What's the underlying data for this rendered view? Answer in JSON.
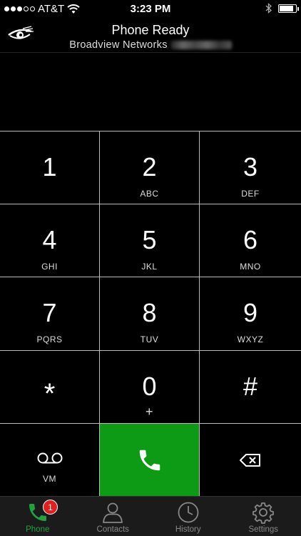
{
  "status_bar": {
    "carrier": "AT&T",
    "time": "3:23 PM",
    "signal_bars_filled": 3,
    "signal_bars_total": 5,
    "battery_level": 0.85
  },
  "header": {
    "title": "Phone Ready",
    "subtitle": "Broadview Networks",
    "logo_icon": "eye-logo-icon"
  },
  "keypad": {
    "keys": [
      {
        "digit": "1",
        "letters": ""
      },
      {
        "digit": "2",
        "letters": "ABC"
      },
      {
        "digit": "3",
        "letters": "DEF"
      },
      {
        "digit": "4",
        "letters": "GHI"
      },
      {
        "digit": "5",
        "letters": "JKL"
      },
      {
        "digit": "6",
        "letters": "MNO"
      },
      {
        "digit": "7",
        "letters": "PQRS"
      },
      {
        "digit": "8",
        "letters": "TUV"
      },
      {
        "digit": "9",
        "letters": "WXYZ"
      },
      {
        "digit": "*",
        "letters": ""
      },
      {
        "digit": "0",
        "letters": "+"
      },
      {
        "digit": "#",
        "letters": ""
      }
    ],
    "voicemail_label": "VM",
    "call_color": "#0d9a15"
  },
  "tabbar": {
    "tabs": [
      {
        "label": "Phone",
        "icon": "phone-icon",
        "active": true,
        "badge": "1"
      },
      {
        "label": "Contacts",
        "icon": "contacts-icon",
        "active": false
      },
      {
        "label": "History",
        "icon": "clock-icon",
        "active": false
      },
      {
        "label": "Settings",
        "icon": "gear-icon",
        "active": false
      }
    ],
    "active_color": "#1fa33a",
    "badge_color": "#e02020"
  }
}
